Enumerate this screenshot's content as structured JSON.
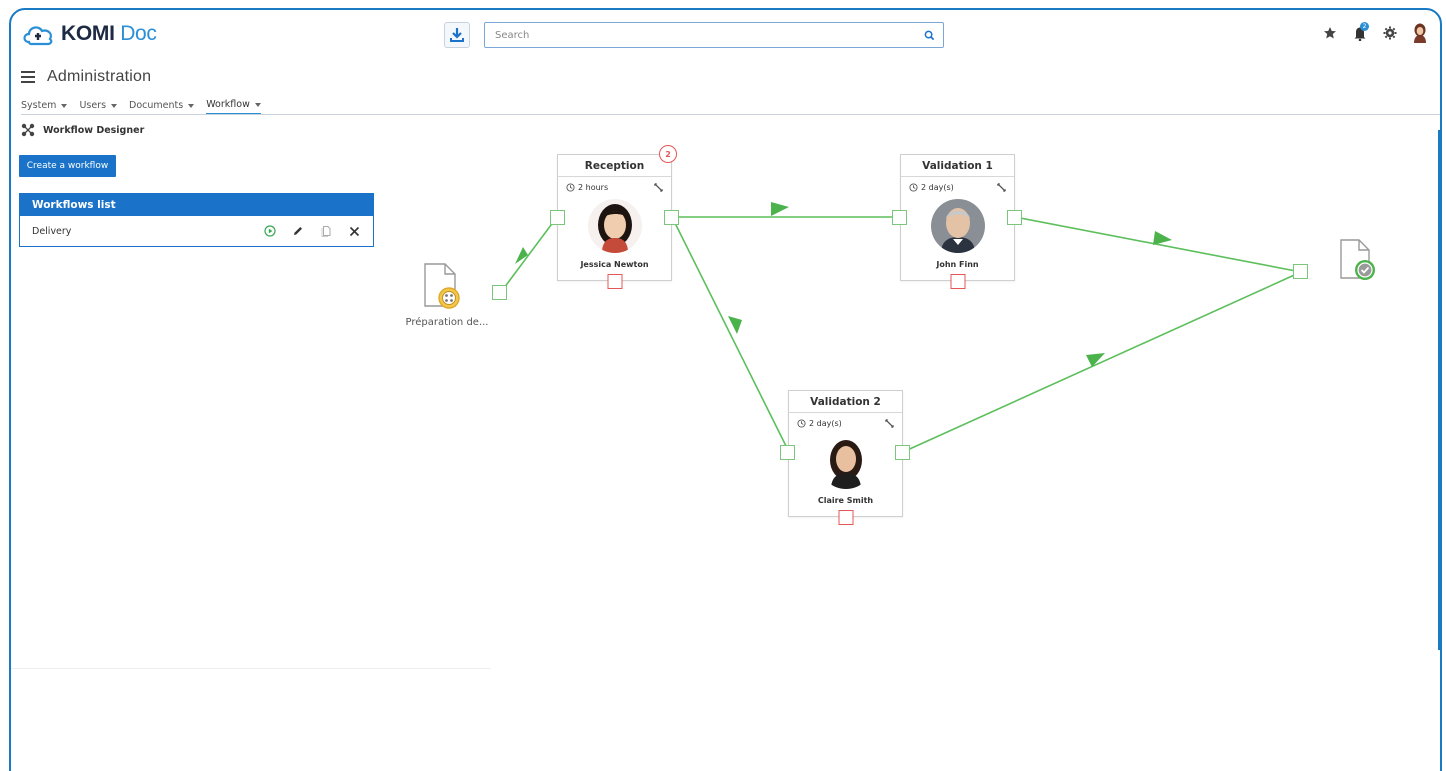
{
  "header": {
    "logo_main": "KOMI",
    "logo_sub": "Doc",
    "search_placeholder": "Search",
    "notification_count": "2"
  },
  "page": {
    "title": "Administration",
    "menu": [
      {
        "label": "System"
      },
      {
        "label": "Users"
      },
      {
        "label": "Documents"
      },
      {
        "label": "Workflow"
      }
    ],
    "section_title": "Workflow Designer"
  },
  "sidebar": {
    "create_button": "Create a workflow",
    "list_header": "Workflows list",
    "workflows": [
      {
        "name": "Delivery"
      }
    ]
  },
  "designer": {
    "start_label": "Préparation de...",
    "steps": [
      {
        "title": "Reception",
        "duration": "2 hours",
        "assignee": "Jessica Newton",
        "badge": "2"
      },
      {
        "title": "Validation 1",
        "duration": "2 day(s)",
        "assignee": "John Finn"
      },
      {
        "title": "Validation 2",
        "duration": "2 day(s)",
        "assignee": "Claire Smith"
      }
    ]
  },
  "colors": {
    "accent": "#1a73c9",
    "frame": "#1a7ac4",
    "connector": "#5cbf5c",
    "reject_port": "#e45757"
  }
}
